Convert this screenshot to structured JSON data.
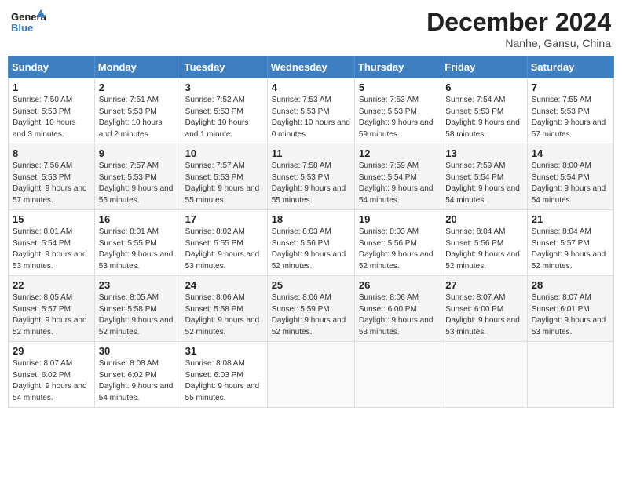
{
  "header": {
    "logo_text_general": "General",
    "logo_text_blue": "Blue",
    "month_title": "December 2024",
    "location": "Nanhe, Gansu, China"
  },
  "weekdays": [
    "Sunday",
    "Monday",
    "Tuesday",
    "Wednesday",
    "Thursday",
    "Friday",
    "Saturday"
  ],
  "weeks": [
    [
      {
        "day": "1",
        "sunrise": "7:50 AM",
        "sunset": "5:53 PM",
        "daylight": "10 hours and 3 minutes."
      },
      {
        "day": "2",
        "sunrise": "7:51 AM",
        "sunset": "5:53 PM",
        "daylight": "10 hours and 2 minutes."
      },
      {
        "day": "3",
        "sunrise": "7:52 AM",
        "sunset": "5:53 PM",
        "daylight": "10 hours and 1 minute."
      },
      {
        "day": "4",
        "sunrise": "7:53 AM",
        "sunset": "5:53 PM",
        "daylight": "10 hours and 0 minutes."
      },
      {
        "day": "5",
        "sunrise": "7:53 AM",
        "sunset": "5:53 PM",
        "daylight": "9 hours and 59 minutes."
      },
      {
        "day": "6",
        "sunrise": "7:54 AM",
        "sunset": "5:53 PM",
        "daylight": "9 hours and 58 minutes."
      },
      {
        "day": "7",
        "sunrise": "7:55 AM",
        "sunset": "5:53 PM",
        "daylight": "9 hours and 57 minutes."
      }
    ],
    [
      {
        "day": "8",
        "sunrise": "7:56 AM",
        "sunset": "5:53 PM",
        "daylight": "9 hours and 57 minutes."
      },
      {
        "day": "9",
        "sunrise": "7:57 AM",
        "sunset": "5:53 PM",
        "daylight": "9 hours and 56 minutes."
      },
      {
        "day": "10",
        "sunrise": "7:57 AM",
        "sunset": "5:53 PM",
        "daylight": "9 hours and 55 minutes."
      },
      {
        "day": "11",
        "sunrise": "7:58 AM",
        "sunset": "5:53 PM",
        "daylight": "9 hours and 55 minutes."
      },
      {
        "day": "12",
        "sunrise": "7:59 AM",
        "sunset": "5:54 PM",
        "daylight": "9 hours and 54 minutes."
      },
      {
        "day": "13",
        "sunrise": "7:59 AM",
        "sunset": "5:54 PM",
        "daylight": "9 hours and 54 minutes."
      },
      {
        "day": "14",
        "sunrise": "8:00 AM",
        "sunset": "5:54 PM",
        "daylight": "9 hours and 54 minutes."
      }
    ],
    [
      {
        "day": "15",
        "sunrise": "8:01 AM",
        "sunset": "5:54 PM",
        "daylight": "9 hours and 53 minutes."
      },
      {
        "day": "16",
        "sunrise": "8:01 AM",
        "sunset": "5:55 PM",
        "daylight": "9 hours and 53 minutes."
      },
      {
        "day": "17",
        "sunrise": "8:02 AM",
        "sunset": "5:55 PM",
        "daylight": "9 hours and 53 minutes."
      },
      {
        "day": "18",
        "sunrise": "8:03 AM",
        "sunset": "5:56 PM",
        "daylight": "9 hours and 52 minutes."
      },
      {
        "day": "19",
        "sunrise": "8:03 AM",
        "sunset": "5:56 PM",
        "daylight": "9 hours and 52 minutes."
      },
      {
        "day": "20",
        "sunrise": "8:04 AM",
        "sunset": "5:56 PM",
        "daylight": "9 hours and 52 minutes."
      },
      {
        "day": "21",
        "sunrise": "8:04 AM",
        "sunset": "5:57 PM",
        "daylight": "9 hours and 52 minutes."
      }
    ],
    [
      {
        "day": "22",
        "sunrise": "8:05 AM",
        "sunset": "5:57 PM",
        "daylight": "9 hours and 52 minutes."
      },
      {
        "day": "23",
        "sunrise": "8:05 AM",
        "sunset": "5:58 PM",
        "daylight": "9 hours and 52 minutes."
      },
      {
        "day": "24",
        "sunrise": "8:06 AM",
        "sunset": "5:58 PM",
        "daylight": "9 hours and 52 minutes."
      },
      {
        "day": "25",
        "sunrise": "8:06 AM",
        "sunset": "5:59 PM",
        "daylight": "9 hours and 52 minutes."
      },
      {
        "day": "26",
        "sunrise": "8:06 AM",
        "sunset": "6:00 PM",
        "daylight": "9 hours and 53 minutes."
      },
      {
        "day": "27",
        "sunrise": "8:07 AM",
        "sunset": "6:00 PM",
        "daylight": "9 hours and 53 minutes."
      },
      {
        "day": "28",
        "sunrise": "8:07 AM",
        "sunset": "6:01 PM",
        "daylight": "9 hours and 53 minutes."
      }
    ],
    [
      {
        "day": "29",
        "sunrise": "8:07 AM",
        "sunset": "6:02 PM",
        "daylight": "9 hours and 54 minutes."
      },
      {
        "day": "30",
        "sunrise": "8:08 AM",
        "sunset": "6:02 PM",
        "daylight": "9 hours and 54 minutes."
      },
      {
        "day": "31",
        "sunrise": "8:08 AM",
        "sunset": "6:03 PM",
        "daylight": "9 hours and 55 minutes."
      },
      null,
      null,
      null,
      null
    ]
  ]
}
